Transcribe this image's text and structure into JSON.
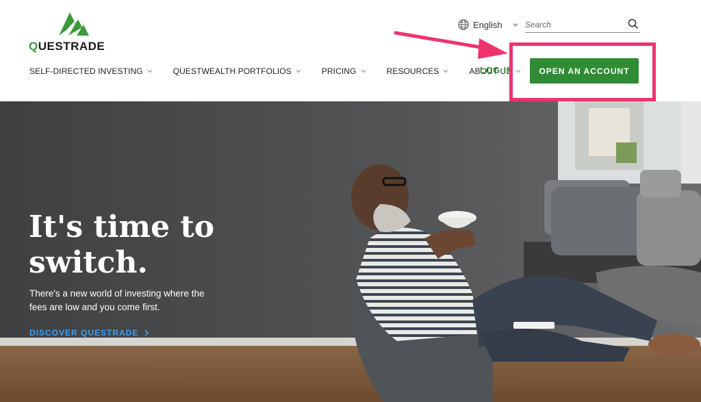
{
  "brand": {
    "name_prefix": "Q",
    "name_rest": "UESTRADE",
    "accent": "#2f8c34"
  },
  "header": {
    "language": "English",
    "search_placeholder": "Search",
    "nav": [
      {
        "label": "SELF-DIRECTED INVESTING"
      },
      {
        "label": "QUESTWEALTH PORTFOLIOS"
      },
      {
        "label": "PRICING"
      },
      {
        "label": "RESOURCES"
      },
      {
        "label": "ABOUT US"
      }
    ],
    "login": "LOG IN",
    "cta": "OPEN AN ACCOUNT"
  },
  "annotation": {
    "color": "#f0336d"
  },
  "hero": {
    "title": "It's time to switch.",
    "subtitle": "There's a new world of investing where the fees are low and you come first.",
    "link": "DISCOVER QUESTRADE",
    "link_color": "#3f9ef0"
  },
  "icons": [
    "logo-icon",
    "globe-icon",
    "chevron-down-icon",
    "search-icon",
    "caret-down-icon",
    "chevron-right-icon"
  ]
}
